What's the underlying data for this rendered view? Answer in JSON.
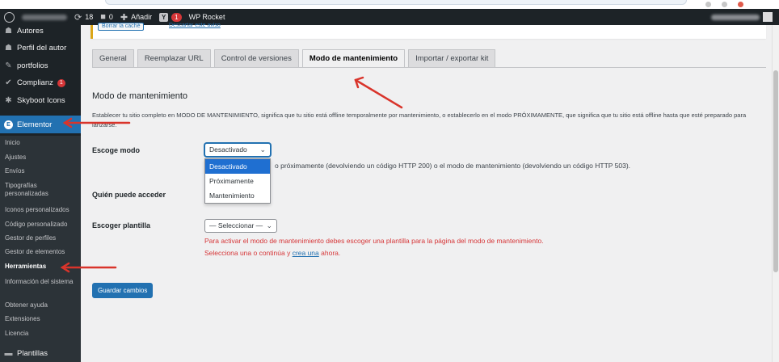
{
  "adminbar": {
    "comments_count": "18",
    "pending_count": "0",
    "add_new": "Añadir",
    "yoast_badge": "1",
    "plugin": "WP Rocket"
  },
  "sidebar": {
    "items": [
      {
        "label": "Autores",
        "icon": "users-icon"
      },
      {
        "label": "Perfil del autor",
        "icon": "users-icon"
      },
      {
        "label": "portfolios",
        "icon": "pin-icon"
      },
      {
        "label": "Complianz",
        "icon": "check-icon",
        "badge": "1"
      },
      {
        "label": "Skyboot Icons",
        "icon": "gear-icon"
      },
      {
        "label": "Elementor",
        "icon": "elementor-icon"
      }
    ],
    "submenu": [
      "Inicio",
      "Ajustes",
      "Envíos",
      "Tipografías personalizadas",
      "Iconos personalizados",
      "Código personalizado",
      "Gestor de perfiles",
      "Gestor de elementos",
      "Herramientas",
      "Información del sistema",
      "Obtener ayuda",
      "Extensiones",
      "Licencia"
    ],
    "last_item": {
      "label": "Plantillas",
      "icon": "folder-icon"
    }
  },
  "notice": {
    "button": "Borrar la caché",
    "link": "Descartar este aviso"
  },
  "tabs": [
    "General",
    "Reemplazar URL",
    "Control de versiones",
    "Modo de mantenimiento",
    "Importar / exportar kit"
  ],
  "active_tab": "Modo de mantenimiento",
  "section": {
    "title": "Modo de mantenimiento",
    "description": "Establecer tu sitio completo en MODO DE MANTENIMIENTO, significa que tu sitio está offline temporalmente por mantenimiento, o establecerlo en el modo PRÓXIMAMENTE, que significa que tu sitio está offline hasta que esté preparado para lanzarse."
  },
  "fields": {
    "mode": {
      "label": "Escoge modo",
      "value": "Desactivado",
      "options": [
        "Desactivado",
        "Próximamente",
        "Mantenimiento"
      ],
      "help": "o próximamente (devolviendo un código HTTP 200) o el modo de mantenimiento (devolviendo un código HTTP 503)."
    },
    "access": {
      "label": "Quién puede acceder"
    },
    "template": {
      "label": "Escoger plantilla",
      "value": "— Seleccionar —",
      "error_line1": "Para activar el modo de mantenimiento debes escoger una plantilla para la página del modo de mantenimiento.",
      "error_line2_before": "Selecciona una o continúa y ",
      "error_link": "crea una",
      "error_line2_after": " ahora."
    }
  },
  "save_button": "Guardar cambios",
  "colors": {
    "admin_bg": "#1d2327",
    "accent": "#2271b1",
    "error": "#d63638",
    "arrow": "#d9342b"
  }
}
